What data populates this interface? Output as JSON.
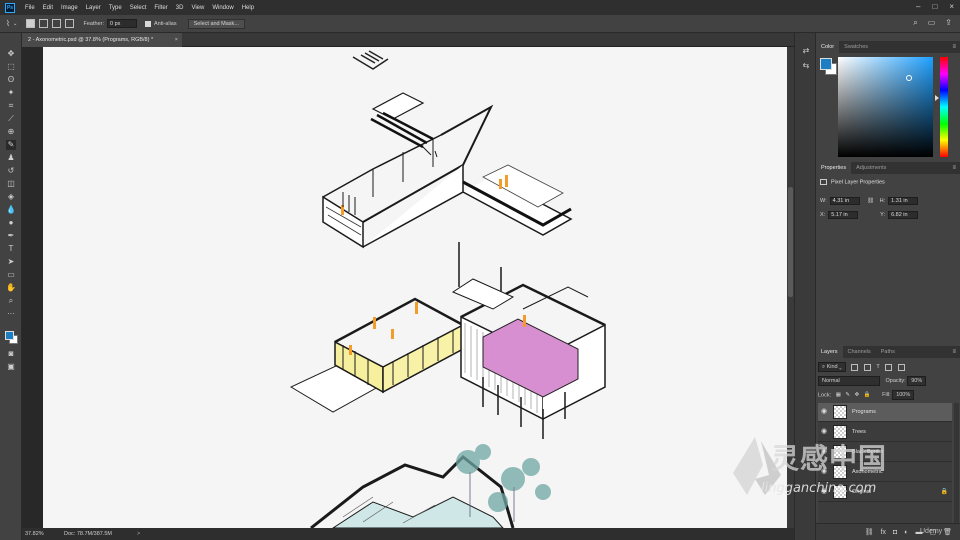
{
  "app": {
    "logo_text": "Ps",
    "menu": [
      "File",
      "Edit",
      "Image",
      "Layer",
      "Type",
      "Select",
      "Filter",
      "3D",
      "View",
      "Window",
      "Help"
    ]
  },
  "options_bar": {
    "feather_label": "Feather:",
    "feather_value": "0 px",
    "anti_alias_label": "Anti-alias",
    "select_mask_label": "Select and Mask..."
  },
  "document": {
    "tab_title": "2 - Axonometric.psd @ 37.8% (Programs, RGB/8) *",
    "close_glyph": "×"
  },
  "status": {
    "zoom": "37.82%",
    "doc_info": "Doc: 78.7M/387.5M",
    "arrow": ">"
  },
  "color_panel": {
    "tabs": [
      "Color",
      "Swatches"
    ],
    "foreground": "#1d7fc3",
    "background": "#ffffff"
  },
  "properties_panel": {
    "tabs": [
      "Properties",
      "Adjustments"
    ],
    "heading": "Pixel Layer Properties",
    "w_label": "W:",
    "w_value": "4.31 in",
    "h_label": "H:",
    "h_value": "1.31 in",
    "x_label": "X:",
    "x_value": "5.17 in",
    "y_label": "Y:",
    "y_value": "6.82 in"
  },
  "layers_panel": {
    "tabs": [
      "Layers",
      "Channels",
      "Paths"
    ],
    "filter_kind": "Kind",
    "blend_mode": "Normal",
    "opacity_label": "Opacity:",
    "opacity_value": "90%",
    "lock_label": "Lock:",
    "fill_label": "Fill:",
    "fill_value": "100%",
    "layers": [
      {
        "name": "Programs",
        "selected": true,
        "locked": false
      },
      {
        "name": "Trees",
        "selected": false,
        "locked": false
      },
      {
        "name": "Black Border",
        "selected": false,
        "locked": false
      },
      {
        "name": "Axonometric",
        "selected": false,
        "locked": false
      },
      {
        "name": "Original",
        "selected": false,
        "locked": true
      }
    ]
  },
  "watermark": {
    "main": "灵感中国",
    "sub": "lingganchina.com",
    "corner": "Udemy"
  }
}
